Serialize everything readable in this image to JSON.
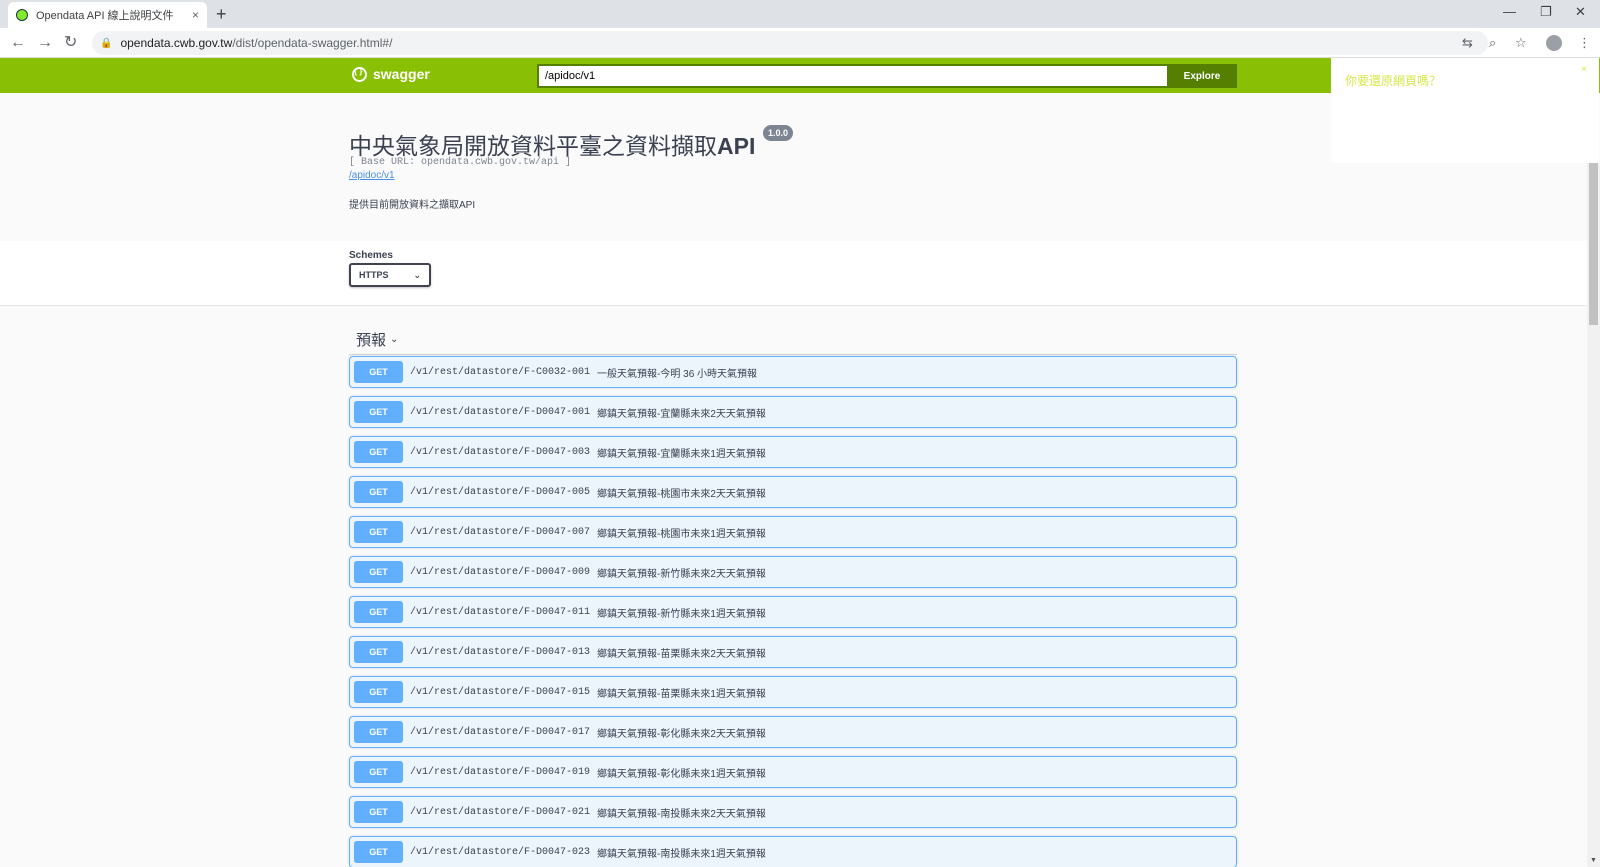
{
  "browser": {
    "tab_title": "Opendata API 線上說明文件",
    "tab_close": "×",
    "new_tab": "+",
    "minimize": "—",
    "restore": "❐",
    "close": "✕",
    "back": "←",
    "forward": "→",
    "reload": "↻",
    "lock": "🔒",
    "url_host": "opendata.cwb.gov.tw",
    "url_path": "/dist/opendata-swagger.html#/",
    "translate": "⇆",
    "zoom": "⌕",
    "bookmark": "☆",
    "menu": "⋮"
  },
  "topbar": {
    "logo_text": "swagger",
    "api_url": "/apidoc/v1",
    "explore_label": "Explore",
    "brand_color": "#89bf04"
  },
  "popup": {
    "text": "你要還原網頁嗎？",
    "close": "×"
  },
  "info": {
    "title_cjk": "中央氣象局開放資料平臺之資料擷取",
    "title_api": "API",
    "version": "1.0.0",
    "base_url": "[ Base URL: opendata.cwb.gov.tw/api ]",
    "api_link": "/apidoc/v1",
    "description": "提供目前開放資料之擷取API"
  },
  "schemes": {
    "label": "Schemes",
    "selected": "HTTPS",
    "chevron": "⌄"
  },
  "section": {
    "title": "預報",
    "chevron": "⌄"
  },
  "operations": [
    {
      "method": "GET",
      "path": "/v1/rest/datastore/F-C0032-001",
      "summary": "一般天氣預報-今明 36 小時天氣預報"
    },
    {
      "method": "GET",
      "path": "/v1/rest/datastore/F-D0047-001",
      "summary": "鄉鎮天氣預報-宜蘭縣未來2天天氣預報"
    },
    {
      "method": "GET",
      "path": "/v1/rest/datastore/F-D0047-003",
      "summary": "鄉鎮天氣預報-宜蘭縣未來1週天氣預報"
    },
    {
      "method": "GET",
      "path": "/v1/rest/datastore/F-D0047-005",
      "summary": "鄉鎮天氣預報-桃園市未來2天天氣預報"
    },
    {
      "method": "GET",
      "path": "/v1/rest/datastore/F-D0047-007",
      "summary": "鄉鎮天氣預報-桃園市未來1週天氣預報"
    },
    {
      "method": "GET",
      "path": "/v1/rest/datastore/F-D0047-009",
      "summary": "鄉鎮天氣預報-新竹縣未來2天天氣預報"
    },
    {
      "method": "GET",
      "path": "/v1/rest/datastore/F-D0047-011",
      "summary": "鄉鎮天氣預報-新竹縣未來1週天氣預報"
    },
    {
      "method": "GET",
      "path": "/v1/rest/datastore/F-D0047-013",
      "summary": "鄉鎮天氣預報-苗栗縣未來2天天氣預報"
    },
    {
      "method": "GET",
      "path": "/v1/rest/datastore/F-D0047-015",
      "summary": "鄉鎮天氣預報-苗栗縣未來1週天氣預報"
    },
    {
      "method": "GET",
      "path": "/v1/rest/datastore/F-D0047-017",
      "summary": "鄉鎮天氣預報-彰化縣未來2天天氣預報"
    },
    {
      "method": "GET",
      "path": "/v1/rest/datastore/F-D0047-019",
      "summary": "鄉鎮天氣預報-彰化縣未來1週天氣預報"
    },
    {
      "method": "GET",
      "path": "/v1/rest/datastore/F-D0047-021",
      "summary": "鄉鎮天氣預報-南投縣未來2天天氣預報"
    },
    {
      "method": "GET",
      "path": "/v1/rest/datastore/F-D0047-023",
      "summary": "鄉鎮天氣預報-南投縣未來1週天氣預報"
    }
  ],
  "colors": {
    "get_method": "#61affe",
    "get_bg": "#ecf4fc"
  }
}
